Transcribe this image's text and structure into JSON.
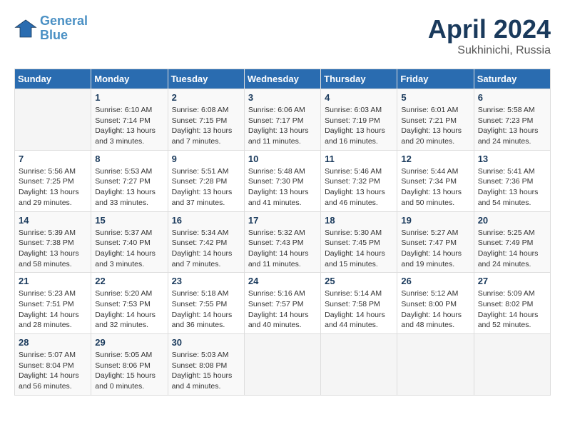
{
  "header": {
    "logo_line1": "General",
    "logo_line2": "Blue",
    "month_title": "April 2024",
    "subtitle": "Sukhinichi, Russia"
  },
  "weekdays": [
    "Sunday",
    "Monday",
    "Tuesday",
    "Wednesday",
    "Thursday",
    "Friday",
    "Saturday"
  ],
  "weeks": [
    [
      {
        "day": "",
        "sunrise": "",
        "sunset": "",
        "daylight": ""
      },
      {
        "day": "1",
        "sunrise": "6:10 AM",
        "sunset": "7:14 PM",
        "daylight": "13 hours and 3 minutes."
      },
      {
        "day": "2",
        "sunrise": "6:08 AM",
        "sunset": "7:15 PM",
        "daylight": "13 hours and 7 minutes."
      },
      {
        "day": "3",
        "sunrise": "6:06 AM",
        "sunset": "7:17 PM",
        "daylight": "13 hours and 11 minutes."
      },
      {
        "day": "4",
        "sunrise": "6:03 AM",
        "sunset": "7:19 PM",
        "daylight": "13 hours and 16 minutes."
      },
      {
        "day": "5",
        "sunrise": "6:01 AM",
        "sunset": "7:21 PM",
        "daylight": "13 hours and 20 minutes."
      },
      {
        "day": "6",
        "sunrise": "5:58 AM",
        "sunset": "7:23 PM",
        "daylight": "13 hours and 24 minutes."
      }
    ],
    [
      {
        "day": "7",
        "sunrise": "5:56 AM",
        "sunset": "7:25 PM",
        "daylight": "13 hours and 29 minutes."
      },
      {
        "day": "8",
        "sunrise": "5:53 AM",
        "sunset": "7:27 PM",
        "daylight": "13 hours and 33 minutes."
      },
      {
        "day": "9",
        "sunrise": "5:51 AM",
        "sunset": "7:28 PM",
        "daylight": "13 hours and 37 minutes."
      },
      {
        "day": "10",
        "sunrise": "5:48 AM",
        "sunset": "7:30 PM",
        "daylight": "13 hours and 41 minutes."
      },
      {
        "day": "11",
        "sunrise": "5:46 AM",
        "sunset": "7:32 PM",
        "daylight": "13 hours and 46 minutes."
      },
      {
        "day": "12",
        "sunrise": "5:44 AM",
        "sunset": "7:34 PM",
        "daylight": "13 hours and 50 minutes."
      },
      {
        "day": "13",
        "sunrise": "5:41 AM",
        "sunset": "7:36 PM",
        "daylight": "13 hours and 54 minutes."
      }
    ],
    [
      {
        "day": "14",
        "sunrise": "5:39 AM",
        "sunset": "7:38 PM",
        "daylight": "13 hours and 58 minutes."
      },
      {
        "day": "15",
        "sunrise": "5:37 AM",
        "sunset": "7:40 PM",
        "daylight": "14 hours and 3 minutes."
      },
      {
        "day": "16",
        "sunrise": "5:34 AM",
        "sunset": "7:42 PM",
        "daylight": "14 hours and 7 minutes."
      },
      {
        "day": "17",
        "sunrise": "5:32 AM",
        "sunset": "7:43 PM",
        "daylight": "14 hours and 11 minutes."
      },
      {
        "day": "18",
        "sunrise": "5:30 AM",
        "sunset": "7:45 PM",
        "daylight": "14 hours and 15 minutes."
      },
      {
        "day": "19",
        "sunrise": "5:27 AM",
        "sunset": "7:47 PM",
        "daylight": "14 hours and 19 minutes."
      },
      {
        "day": "20",
        "sunrise": "5:25 AM",
        "sunset": "7:49 PM",
        "daylight": "14 hours and 24 minutes."
      }
    ],
    [
      {
        "day": "21",
        "sunrise": "5:23 AM",
        "sunset": "7:51 PM",
        "daylight": "14 hours and 28 minutes."
      },
      {
        "day": "22",
        "sunrise": "5:20 AM",
        "sunset": "7:53 PM",
        "daylight": "14 hours and 32 minutes."
      },
      {
        "day": "23",
        "sunrise": "5:18 AM",
        "sunset": "7:55 PM",
        "daylight": "14 hours and 36 minutes."
      },
      {
        "day": "24",
        "sunrise": "5:16 AM",
        "sunset": "7:57 PM",
        "daylight": "14 hours and 40 minutes."
      },
      {
        "day": "25",
        "sunrise": "5:14 AM",
        "sunset": "7:58 PM",
        "daylight": "14 hours and 44 minutes."
      },
      {
        "day": "26",
        "sunrise": "5:12 AM",
        "sunset": "8:00 PM",
        "daylight": "14 hours and 48 minutes."
      },
      {
        "day": "27",
        "sunrise": "5:09 AM",
        "sunset": "8:02 PM",
        "daylight": "14 hours and 52 minutes."
      }
    ],
    [
      {
        "day": "28",
        "sunrise": "5:07 AM",
        "sunset": "8:04 PM",
        "daylight": "14 hours and 56 minutes."
      },
      {
        "day": "29",
        "sunrise": "5:05 AM",
        "sunset": "8:06 PM",
        "daylight": "15 hours and 0 minutes."
      },
      {
        "day": "30",
        "sunrise": "5:03 AM",
        "sunset": "8:08 PM",
        "daylight": "15 hours and 4 minutes."
      },
      {
        "day": "",
        "sunrise": "",
        "sunset": "",
        "daylight": ""
      },
      {
        "day": "",
        "sunrise": "",
        "sunset": "",
        "daylight": ""
      },
      {
        "day": "",
        "sunrise": "",
        "sunset": "",
        "daylight": ""
      },
      {
        "day": "",
        "sunrise": "",
        "sunset": "",
        "daylight": ""
      }
    ]
  ],
  "labels": {
    "sunrise_prefix": "Sunrise: ",
    "sunset_prefix": "Sunset: ",
    "daylight_prefix": "Daylight: "
  }
}
